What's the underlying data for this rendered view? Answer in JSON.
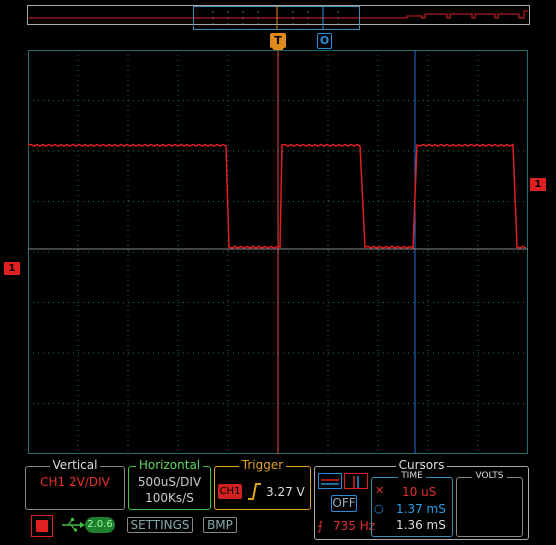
{
  "markers": {
    "trigger": "T",
    "cursor": "O",
    "channel_left": "1",
    "channel_right": "1"
  },
  "vertical": {
    "title": "Vertical",
    "value": "CH1 2V/DIV"
  },
  "horizontal": {
    "title": "Horizontal",
    "scale": "500uS/DIV",
    "rate": "100Ks/S"
  },
  "trigger": {
    "title": "Trigger",
    "channel": "CH1",
    "level": "3.27 V"
  },
  "cursors": {
    "title": "Cursors",
    "off_label": "OFF",
    "time_title": "TIME",
    "volts_title": "VOLTS",
    "t1": "10 uS",
    "t2": "1.37 mS",
    "delta": "1.36 mS",
    "freq": "735 Hz"
  },
  "bottom": {
    "version": "2.0.6",
    "settings": "SETTINGS",
    "bmp": "BMP"
  },
  "colors": {
    "trace": "#e02020",
    "grid": "#1f6f6f",
    "trigger_line": "#e05050",
    "cursor_line": "#2a6fd8"
  },
  "icons": [
    "run-stop-icon",
    "usb-icon",
    "rising-edge-icon",
    "cursor-h-icon",
    "cursor-v-icon"
  ]
}
